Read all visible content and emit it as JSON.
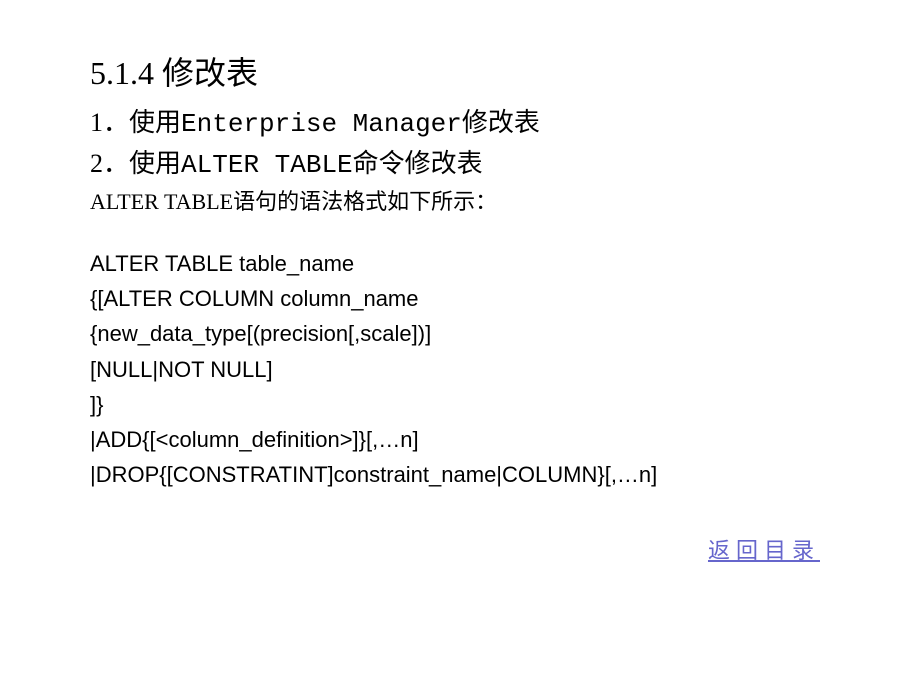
{
  "title": "5.1.4 修改表",
  "subsections": {
    "item1_num": "1．",
    "item1_prefix": "使用",
    "item1_code": "Enterprise Manager",
    "item1_suffix": "修改表",
    "item2_num": "2．",
    "item2_prefix": "使用",
    "item2_code": "ALTER TABLE",
    "item2_suffix": "命令修改表"
  },
  "description": "ALTER TABLE语句的语法格式如下所示：",
  "syntax": {
    "line1": "ALTER TABLE table_name",
    "line2": "{[ALTER COLUMN column_name",
    "line3": "{new_data_type[(precision[,scale])]",
    "line4": "[NULL|NOT NULL]",
    "line5": "]}",
    "line6": "|ADD{[<column_definition>]}[,…n]",
    "line7": "|DROP{[CONSTRATINT]constraint_name|COLUMN}[,…n]"
  },
  "link_back": "返回目录"
}
